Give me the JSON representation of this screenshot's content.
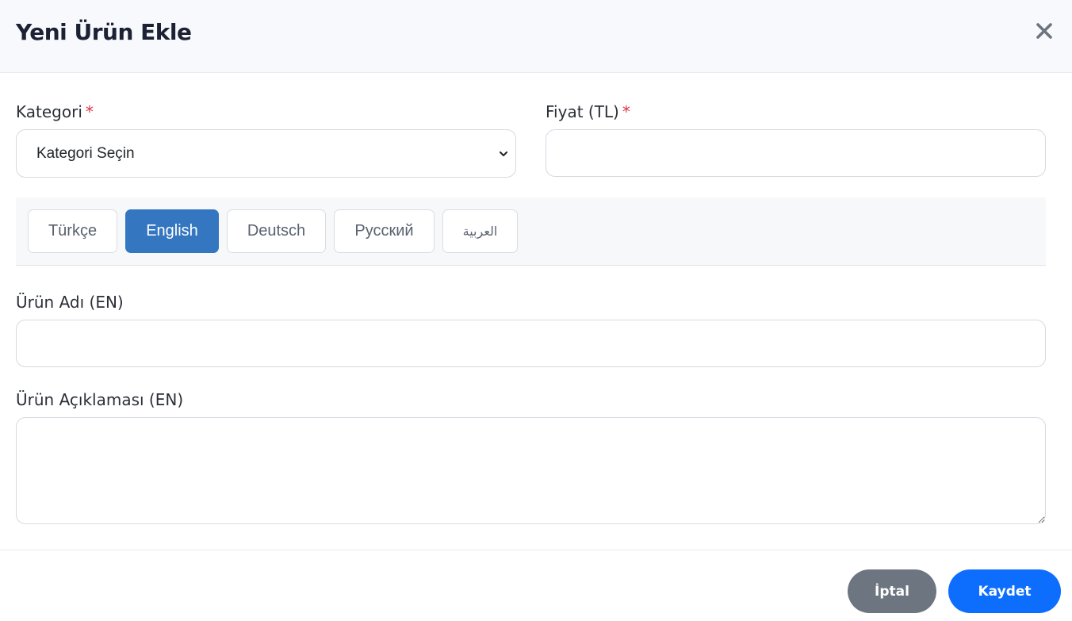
{
  "header": {
    "title": "Yeni Ürün Ekle"
  },
  "form": {
    "category": {
      "label": "Kategori",
      "required_mark": "*",
      "selected": "Kategori Seçin"
    },
    "price": {
      "label": "Fiyat (TL)",
      "required_mark": "*",
      "value": ""
    },
    "languages": [
      {
        "label": "Türkçe",
        "active": false
      },
      {
        "label": "English",
        "active": true
      },
      {
        "label": "Deutsch",
        "active": false
      },
      {
        "label": "Русский",
        "active": false
      },
      {
        "label": "العربية",
        "active": false
      }
    ],
    "product_name": {
      "label": "Ürün Adı (EN)",
      "value": ""
    },
    "product_description": {
      "label": "Ürün Açıklaması (EN)",
      "value": ""
    }
  },
  "footer": {
    "cancel_label": "İptal",
    "save_label": "Kaydet"
  },
  "colors": {
    "primary": "#0d6efd",
    "active_tab": "#3476c0",
    "cancel": "#6d7680",
    "required": "#dc3545",
    "header_bg": "#f8f9fd"
  },
  "icons": {
    "close": "close-icon",
    "select_arrow": "chevron-down-icon"
  }
}
